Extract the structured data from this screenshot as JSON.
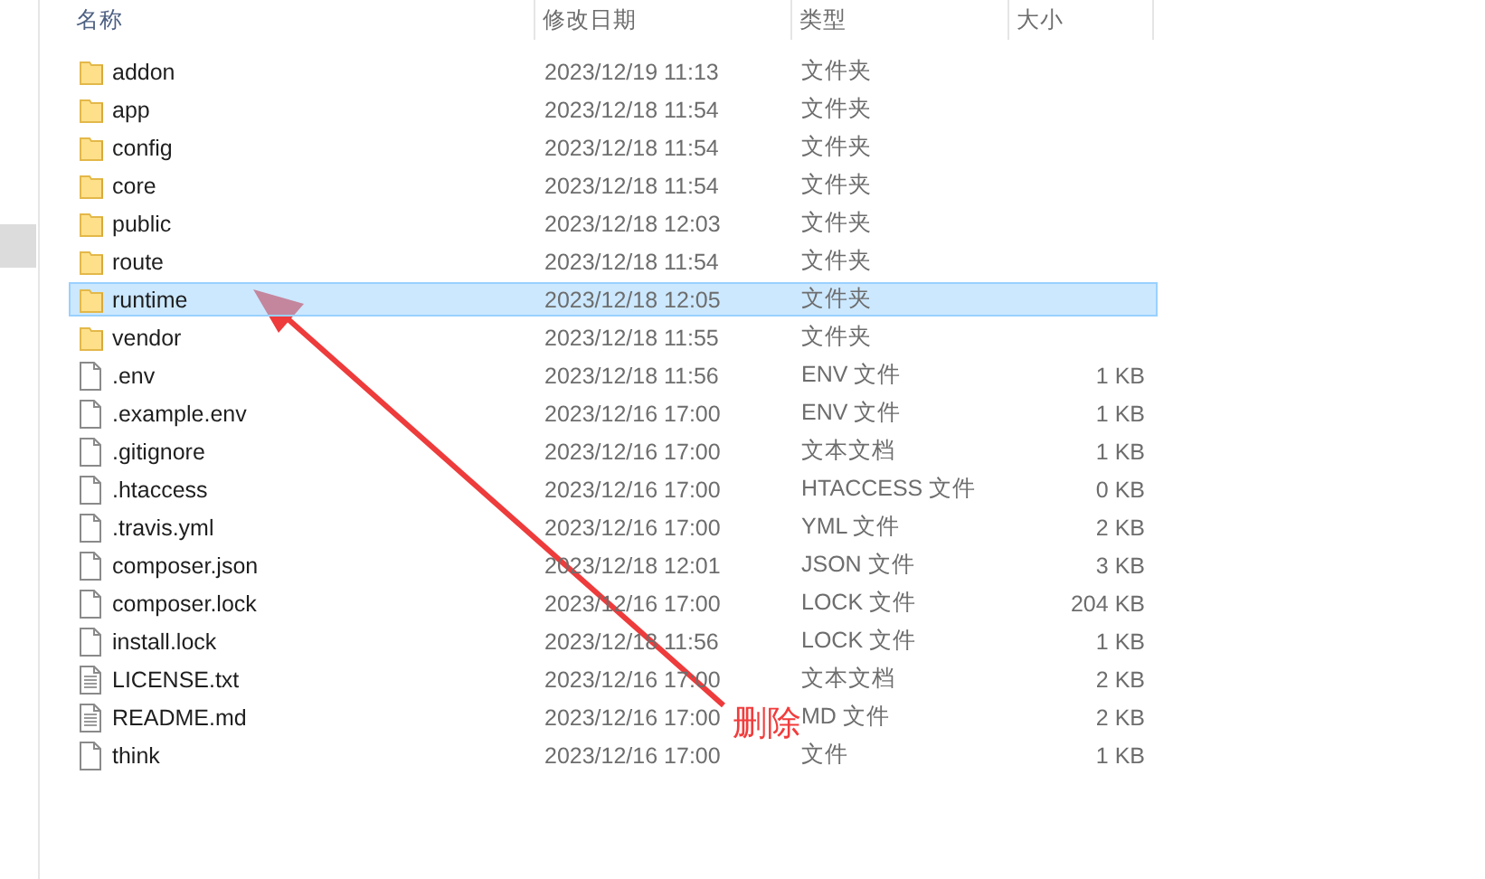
{
  "columns": [
    {
      "label": "名称"
    },
    {
      "label": "修改日期"
    },
    {
      "label": "类型"
    },
    {
      "label": "大小"
    }
  ],
  "rows": [
    {
      "kind": "folder",
      "name": "addon",
      "date": "2023/12/19 11:13",
      "type": "文件夹",
      "selected": false
    },
    {
      "kind": "folder",
      "name": "app",
      "date": "2023/12/18 11:54",
      "type": "文件夹",
      "selected": false
    },
    {
      "kind": "folder",
      "name": "config",
      "date": "2023/12/18 11:54",
      "type": "文件夹",
      "selected": false
    },
    {
      "kind": "folder",
      "name": "core",
      "date": "2023/12/18 11:54",
      "type": "文件夹",
      "selected": false
    },
    {
      "kind": "folder",
      "name": "public",
      "date": "2023/12/18 12:03",
      "type": "文件夹",
      "selected": false
    },
    {
      "kind": "folder",
      "name": "route",
      "date": "2023/12/18 11:54",
      "type": "文件夹",
      "selected": false
    },
    {
      "kind": "folder",
      "name": "runtime",
      "date": "2023/12/18 12:05",
      "type": "文件夹",
      "selected": true
    },
    {
      "kind": "folder",
      "name": "vendor",
      "date": "2023/12/18 11:55",
      "type": "文件夹",
      "selected": false
    },
    {
      "kind": "file",
      "name": ".env",
      "date": "2023/12/18 11:56",
      "type": "ENV 文件",
      "size": "1 KB",
      "selected": false
    },
    {
      "kind": "file",
      "name": ".example.env",
      "date": "2023/12/16 17:00",
      "type": "ENV 文件",
      "size": "1 KB",
      "selected": false
    },
    {
      "kind": "file",
      "name": ".gitignore",
      "date": "2023/12/16 17:00",
      "type": "文本文档",
      "size": "1 KB",
      "selected": false
    },
    {
      "kind": "file",
      "name": ".htaccess",
      "date": "2023/12/16 17:00",
      "type": "HTACCESS 文件",
      "size": "0 KB",
      "selected": false
    },
    {
      "kind": "file",
      "name": ".travis.yml",
      "date": "2023/12/16 17:00",
      "type": "YML 文件",
      "size": "2 KB",
      "selected": false
    },
    {
      "kind": "file",
      "name": "composer.json",
      "date": "2023/12/18 12:01",
      "type": "JSON 文件",
      "size": "3 KB",
      "selected": false
    },
    {
      "kind": "file",
      "name": "composer.lock",
      "date": "2023/12/16 17:00",
      "type": "LOCK 文件",
      "size": "204 KB",
      "selected": false
    },
    {
      "kind": "file",
      "name": "install.lock",
      "date": "2023/12/18 11:56",
      "type": "LOCK 文件",
      "size": "1 KB",
      "selected": false
    },
    {
      "kind": "text",
      "name": "LICENSE.txt",
      "date": "2023/12/16 17:00",
      "type": "文本文档",
      "size": "2 KB",
      "selected": false
    },
    {
      "kind": "text",
      "name": "README.md",
      "date": "2023/12/16 17:00",
      "type": "MD 文件",
      "size": "2 KB",
      "selected": false
    },
    {
      "kind": "file",
      "name": "think",
      "date": "2023/12/16 17:00",
      "type": "文件",
      "size": "1 KB",
      "selected": false
    }
  ],
  "annotation": {
    "label": "删除"
  }
}
